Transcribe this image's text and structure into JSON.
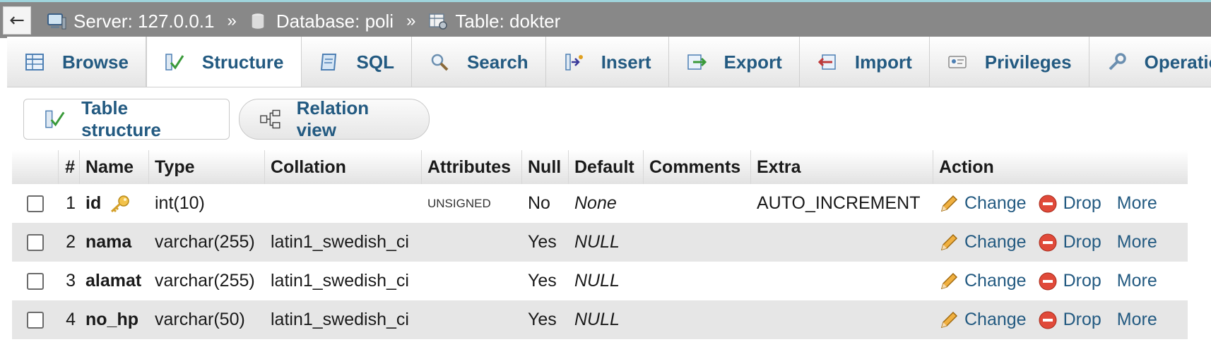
{
  "breadcrumb": {
    "back_label": "←",
    "separator": "»",
    "server": "Server: 127.0.0.1",
    "database": "Database: poli",
    "table": "Table: dokter"
  },
  "tabs": [
    {
      "label": "Browse",
      "icon": "browse-icon"
    },
    {
      "label": "Structure",
      "icon": "structure-icon",
      "active": true
    },
    {
      "label": "SQL",
      "icon": "sql-icon"
    },
    {
      "label": "Search",
      "icon": "search-icon"
    },
    {
      "label": "Insert",
      "icon": "insert-icon"
    },
    {
      "label": "Export",
      "icon": "export-icon"
    },
    {
      "label": "Import",
      "icon": "import-icon"
    },
    {
      "label": "Privileges",
      "icon": "privileges-icon"
    },
    {
      "label": "Operations",
      "icon": "operations-icon"
    }
  ],
  "subnav": {
    "table_structure": "Table structure",
    "relation_view": "Relation view"
  },
  "columns": {
    "num": "#",
    "name": "Name",
    "type": "Type",
    "collation": "Collation",
    "attributes": "Attributes",
    "null": "Null",
    "default": "Default",
    "comments": "Comments",
    "extra": "Extra",
    "action": "Action"
  },
  "rows": [
    {
      "num": "1",
      "name": "id",
      "type": "int(10)",
      "collation": "",
      "attributes": "UNSIGNED",
      "null": "No",
      "default": "None",
      "comments": "",
      "extra": "AUTO_INCREMENT",
      "primary_key": true
    },
    {
      "num": "2",
      "name": "nama",
      "type": "varchar(255)",
      "collation": "latin1_swedish_ci",
      "attributes": "",
      "null": "Yes",
      "default": "NULL",
      "comments": "",
      "extra": ""
    },
    {
      "num": "3",
      "name": "alamat",
      "type": "varchar(255)",
      "collation": "latin1_swedish_ci",
      "attributes": "",
      "null": "Yes",
      "default": "NULL",
      "comments": "",
      "extra": ""
    },
    {
      "num": "4",
      "name": "no_hp",
      "type": "varchar(50)",
      "collation": "latin1_swedish_ci",
      "attributes": "",
      "null": "Yes",
      "default": "NULL",
      "comments": "",
      "extra": ""
    }
  ],
  "actions": {
    "change": "Change",
    "drop": "Drop",
    "more": "More"
  },
  "colors": {
    "link": "#235a81",
    "topbar": "#888888",
    "row_alt": "#e6e6e6"
  }
}
